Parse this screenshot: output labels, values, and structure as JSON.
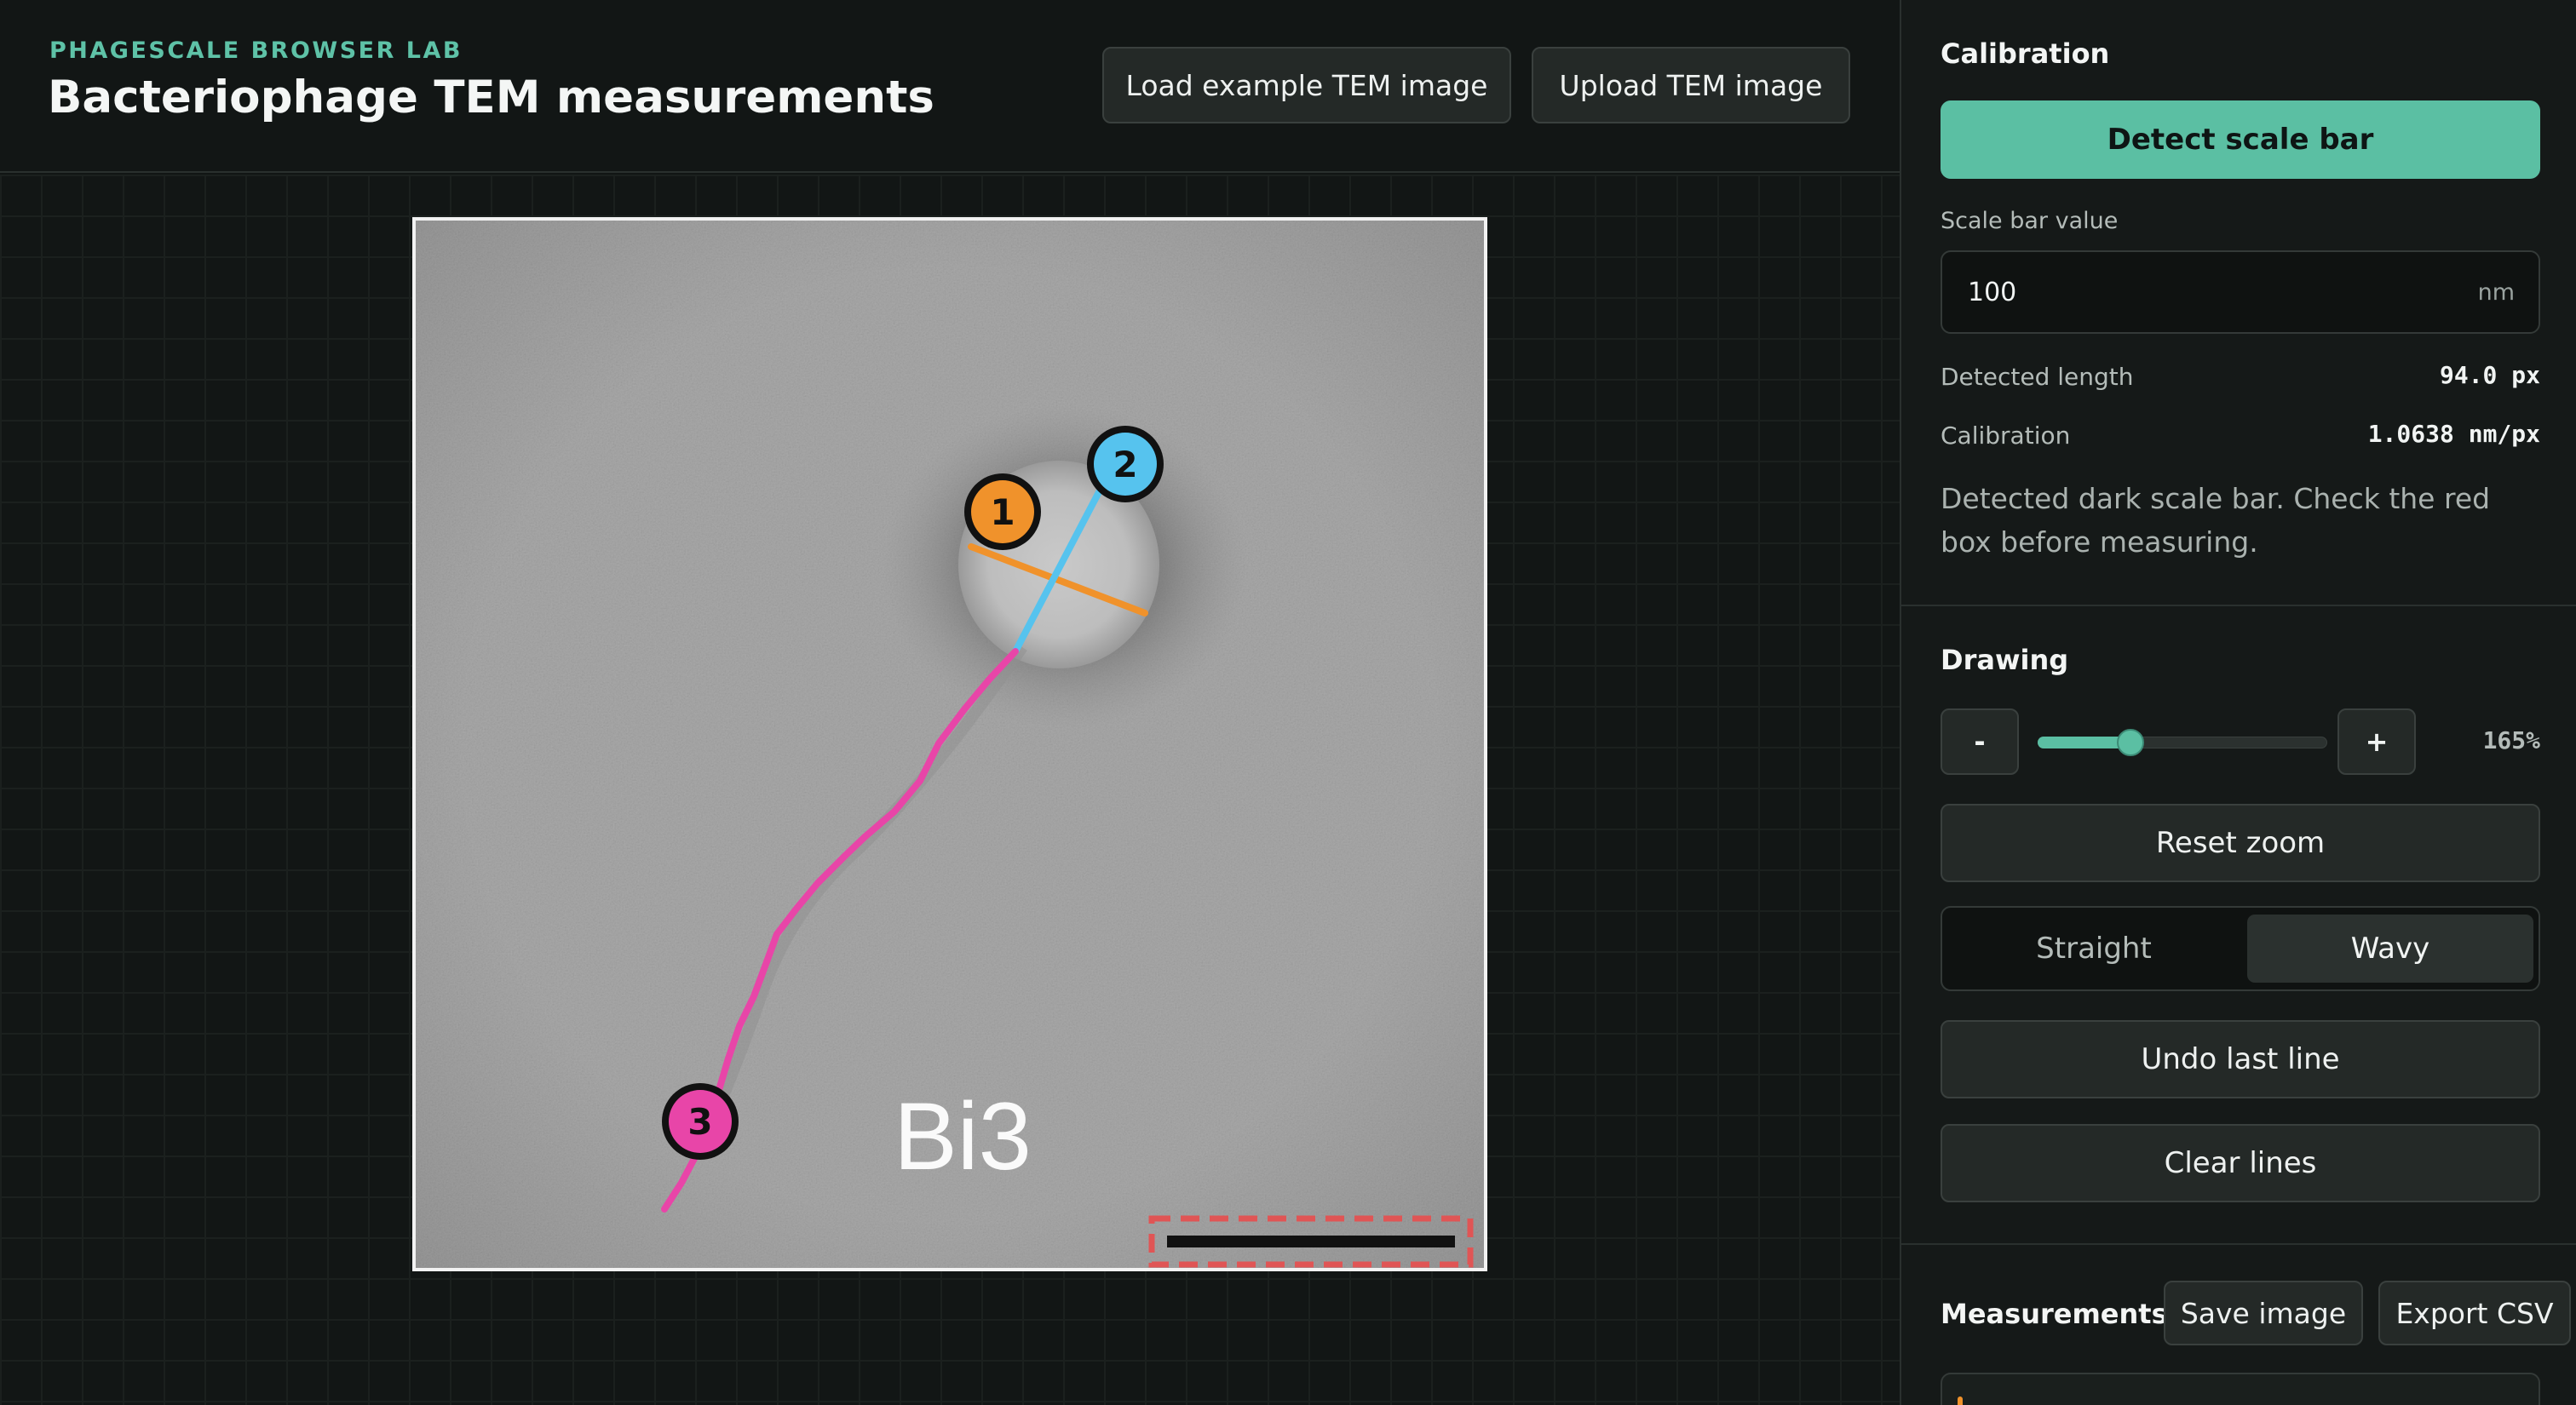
{
  "header": {
    "eyebrow": "PHAGESCALE BROWSER LAB",
    "title": "Bacteriophage TEM measurements",
    "load_example_label": "Load example TEM image",
    "upload_label": "Upload TEM image"
  },
  "canvas": {
    "image_label": "Bi3",
    "markers": [
      {
        "number": "1",
        "color": "#f0922b"
      },
      {
        "number": "2",
        "color": "#56c3ee"
      },
      {
        "number": "3",
        "color": "#e845a8"
      }
    ],
    "scale_box_color": "#e05555",
    "scale_bar_color": "#111111"
  },
  "calibration": {
    "title": "Calibration",
    "detect_label": "Detect scale bar",
    "scale_label": "Scale bar value",
    "scale_value": "100",
    "scale_unit": "nm",
    "detected_length_label": "Detected length",
    "detected_length_value": "94.0 px",
    "calibration_label": "Calibration",
    "calibration_value": "1.0638 nm/px",
    "status": "Detected dark scale bar. Check the red box before measuring."
  },
  "drawing": {
    "title": "Drawing",
    "zoom_out_label": "-",
    "zoom_in_label": "+",
    "zoom_level": "165%",
    "zoom_fraction": 0.32,
    "reset_zoom_label": "Reset zoom",
    "mode_straight": "Straight",
    "mode_wavy": "Wavy",
    "selected_mode": "Wavy",
    "undo_label": "Undo last line",
    "clear_label": "Clear lines"
  },
  "measurements": {
    "title": "Measurements",
    "save_image_label": "Save image",
    "export_csv_label": "Export CSV"
  },
  "colors": {
    "accent": "#5bbfa3",
    "orange": "#f0922b",
    "blue": "#56c3ee",
    "pink": "#e845a8"
  }
}
